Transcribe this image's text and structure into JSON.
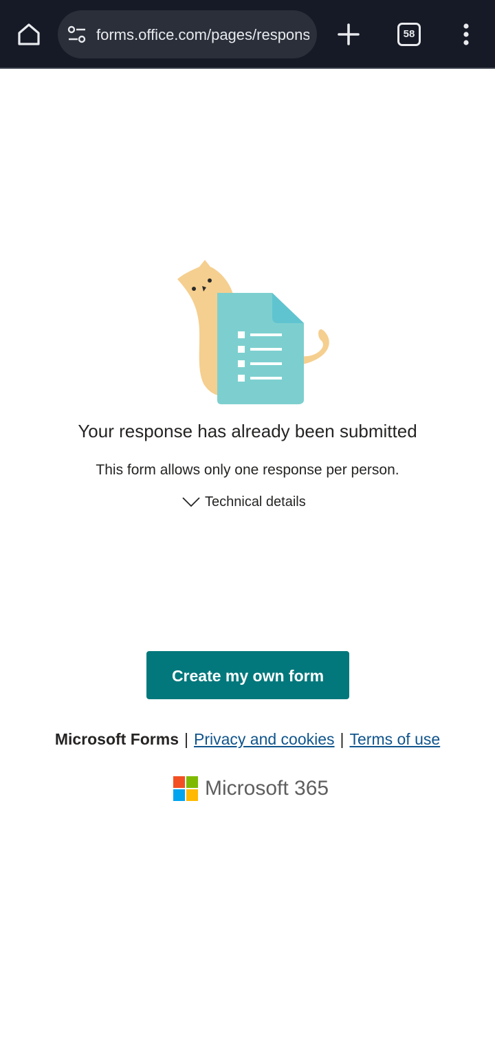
{
  "browser": {
    "url": "forms.office.com/pages/responsepage.aspx",
    "tab_count": "58",
    "icons": {
      "home": "home-icon",
      "site_settings": "tune-icon",
      "new_tab": "plus-icon",
      "tabs": "tab-switcher-icon",
      "menu": "more-vert-icon"
    }
  },
  "content": {
    "title": "Your response has already been submitted",
    "subtitle": "This form allows only one response per person.",
    "technical_details": "Technical details",
    "create_button": "Create my own form"
  },
  "footer": {
    "brand": "Microsoft Forms",
    "separator": "|",
    "privacy_link": "Privacy and cookies",
    "terms_link": "Terms of use",
    "logo_text": "Microsoft 365"
  },
  "colors": {
    "toolbar_bg": "#161a26",
    "button_bg": "#03787c",
    "link": "#0f548c"
  }
}
